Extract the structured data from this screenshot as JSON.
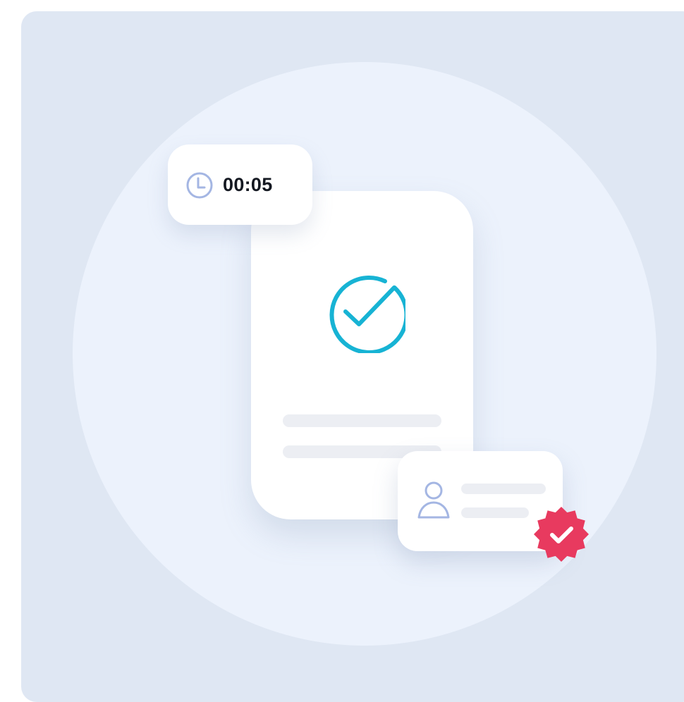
{
  "timer": {
    "value": "00:05",
    "icon": "clock-icon"
  },
  "status": {
    "icon": "checkmark-circle-icon"
  },
  "user_card": {
    "icon": "user-icon",
    "badge_icon": "verified-badge-icon"
  },
  "colors": {
    "background": "#dfe7f3",
    "halo": "#ecf2fc",
    "card": "#ffffff",
    "check_accent": "#17b3d4",
    "clock_icon": "#a4b6e3",
    "user_icon": "#a4b6e3",
    "badge": "#e83a5f",
    "skeleton": "#eceef3",
    "text": "#141821"
  }
}
